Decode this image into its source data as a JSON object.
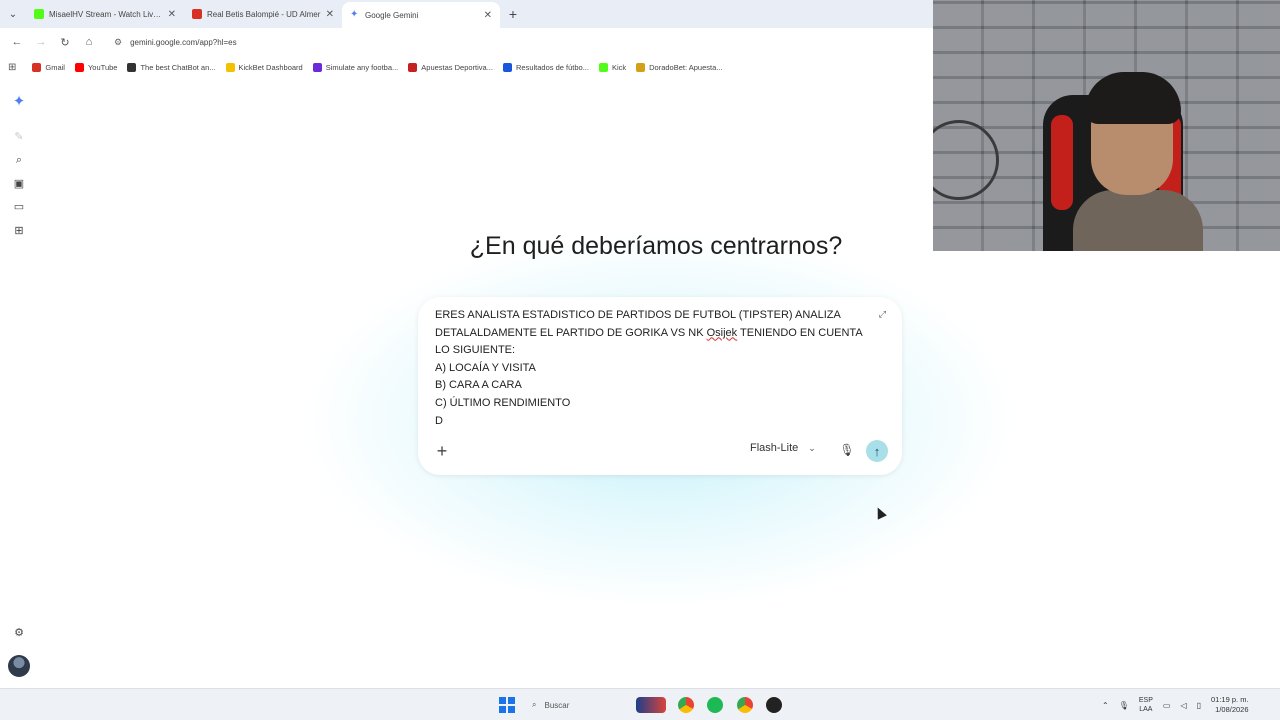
{
  "browser": {
    "tabs": [
      {
        "title": "MisaelHV Stream - Watch Live o",
        "favicon_color": "#53fc18",
        "active": false
      },
      {
        "title": "Real Betis Balompié - UD Almer",
        "favicon_color": "#d93025",
        "active": false
      },
      {
        "title": "Google Gemini",
        "favicon_color": "#4f7ff0",
        "active": true
      }
    ],
    "new_tab": "+",
    "url": "gemini.google.com/app?hl=es",
    "bookmarks": [
      {
        "label": "Gmail",
        "color": "#d93025"
      },
      {
        "label": "YouTube",
        "color": "#ff0000"
      },
      {
        "label": "The best ChatBot an...",
        "color": "#333333"
      },
      {
        "label": "KickBet Dashboard",
        "color": "#f2c200"
      },
      {
        "label": "Simulate any footba...",
        "color": "#6b2bd9"
      },
      {
        "label": "Apuestas Deportiva...",
        "color": "#c5221f"
      },
      {
        "label": "Resultados de fútbo...",
        "color": "#1a56db"
      },
      {
        "label": "Kick",
        "color": "#53fc18"
      },
      {
        "label": "DoradoBet: Apuesta...",
        "color": "#d4a017"
      }
    ]
  },
  "gemini": {
    "headline": "¿En qué deberíamos centrarnos?",
    "prompt": {
      "line1": "ERES ANALISTA ESTADISTICO DE PARTIDOS DE FUTBOL (TIPSTER) ANALIZA",
      "line2_a": "DETALALDAMENTE EL PARTIDO DE GORIKA VS NK ",
      "line2_b": "Osijek",
      "line2_c": " TENIENDO EN CUENTA",
      "line3": "LO SIGUIENTE:",
      "line4": "A) LOCAÍA Y VISITA",
      "line5": "B) CARA A CARA",
      "line6": "C) ÚLTIMO RENDIMIENTO",
      "line7": "D"
    },
    "model": "Flash-Lite",
    "accent": "#a8dfe9"
  },
  "taskbar": {
    "search_placeholder": "Buscar",
    "lang_top": "ESP",
    "lang_bottom": "LAA",
    "time": "01:19 p. m.",
    "date": "1/08/2026"
  }
}
